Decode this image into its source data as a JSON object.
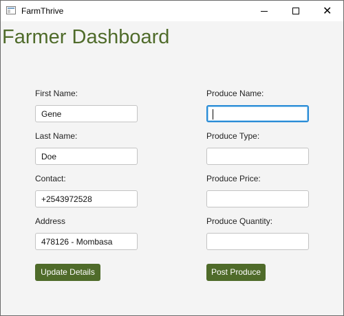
{
  "window": {
    "title": "FarmThrive",
    "close_glyph": "✕"
  },
  "page": {
    "title": "Farmer Dashboard"
  },
  "left_form": {
    "first_name": {
      "label": "First Name:",
      "value": "Gene"
    },
    "last_name": {
      "label": "Last Name:",
      "value": "Doe"
    },
    "contact": {
      "label": "Contact:",
      "value": "+2543972528"
    },
    "address": {
      "label": "Address",
      "value": "478126 - Mombasa"
    },
    "update_button": "Update Details"
  },
  "right_form": {
    "produce_name": {
      "label": "Produce Name:",
      "value": ""
    },
    "produce_type": {
      "label": "Produce Type:",
      "value": ""
    },
    "produce_price": {
      "label": "Produce Price:",
      "value": ""
    },
    "produce_quantity": {
      "label": "Produce Quantity:",
      "value": ""
    },
    "post_button": "Post Produce"
  },
  "colors": {
    "accent": "#4f6b2a",
    "focus": "#2b8cd6",
    "background": "#f4f4f4"
  },
  "icons": {
    "app": "app-window-icon",
    "minimize": "minimize-icon",
    "maximize": "maximize-icon",
    "close": "close-icon"
  }
}
